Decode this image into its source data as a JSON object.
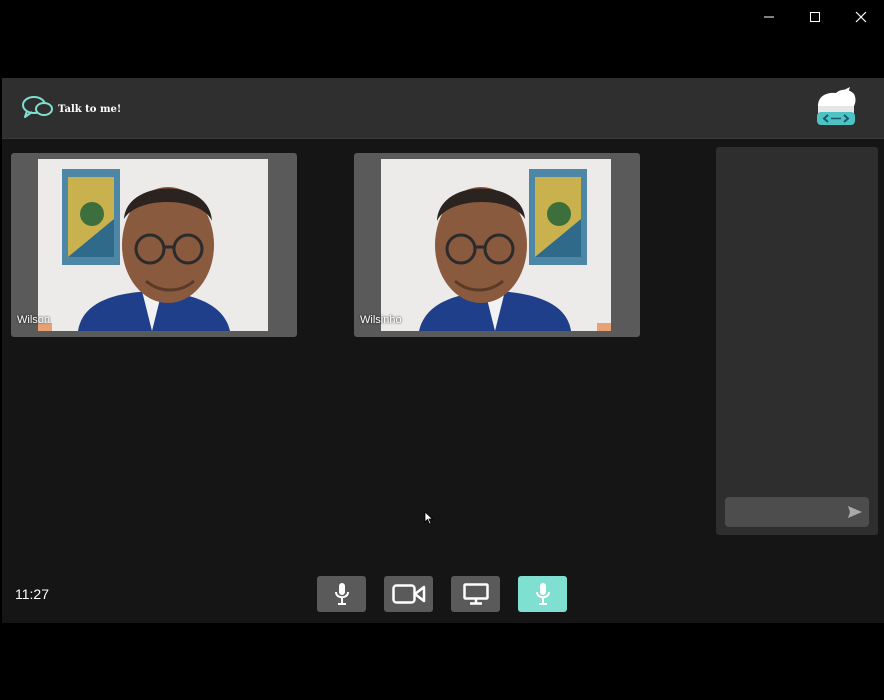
{
  "app": {
    "logo_text": "Talk to me!"
  },
  "participants": [
    {
      "name": "Wilson"
    },
    {
      "name": "Wilsinho"
    }
  ],
  "chat": {
    "input_value": "",
    "placeholder": ""
  },
  "status": {
    "time": "11:27"
  },
  "toolbar": {
    "buttons": [
      {
        "icon": "microphone-icon",
        "active": false
      },
      {
        "icon": "video-camera-icon",
        "active": false
      },
      {
        "icon": "monitor-icon",
        "active": false
      },
      {
        "icon": "microphone-icon",
        "active": true
      }
    ]
  },
  "colors": {
    "accent": "#7fe0d1",
    "header_bg": "#2f2f2f",
    "main_bg": "#151515",
    "tile_bg": "#5a5a5a",
    "chat_bg": "#2e2e2e"
  }
}
